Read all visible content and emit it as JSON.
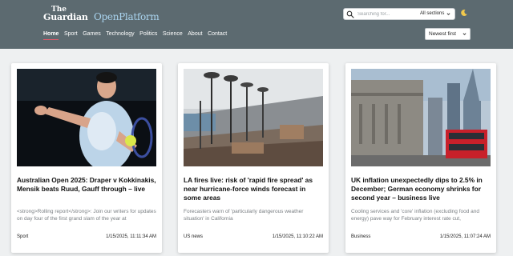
{
  "header": {
    "logo_the": "The",
    "logo_guardian": "Guardian",
    "logo_open_platform": "OpenPlatform",
    "search_placeholder": "Searching for...",
    "section_select": "All sections",
    "theme_icon": "moon-icon",
    "search_icon": "search-icon"
  },
  "nav": {
    "items": [
      "Home",
      "Sport",
      "Games",
      "Technology",
      "Politics",
      "Science",
      "About",
      "Contact"
    ],
    "active": "Home"
  },
  "sort": {
    "selected": "Newest first"
  },
  "colors": {
    "header_bg": "#5c6a70",
    "open_platform_accent": "#a9d3ee",
    "active_underline": "#e05a6a",
    "page_bg": "#eef0f1"
  },
  "cards": [
    {
      "title": "Australian Open 2025: Draper v Kokkinakis, Mensik beats Ruud, Gauff through – live",
      "summary": "<strong>Rolling report</strong>: Join our writers for updates on day four of the first grand slam of the year at",
      "section": "Sport",
      "time": "1/15/2025, 11:11:34 AM"
    },
    {
      "title": "LA fires live: risk of 'rapid fire spread' as near hurricane-force winds forecast in some areas",
      "summary": "Forecasters warn of 'particularly dangerous weather situation' in California",
      "section": "US news",
      "time": "1/15/2025, 11:10:22 AM"
    },
    {
      "title": "UK inflation unexpectedly dips to 2.5% in December; German economy shrinks for second year – business live",
      "summary": "Cooling services and 'core' inflation (excluding food and energy) pave way for February interest rate cut,",
      "section": "Business",
      "time": "1/15/2025, 11:07:24 AM"
    }
  ]
}
